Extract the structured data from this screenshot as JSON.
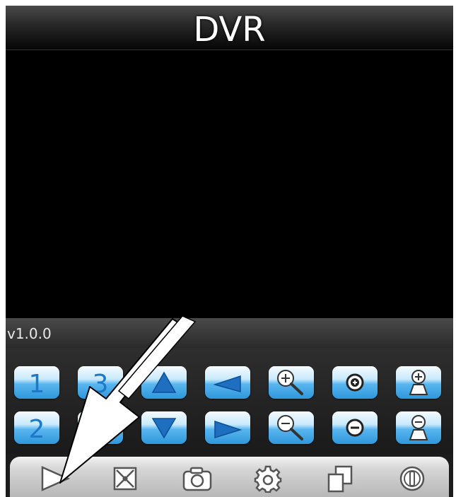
{
  "app": {
    "title": "DVR",
    "version": "v1.0.0"
  },
  "controls": {
    "channel_1": "1",
    "channel_2": "2",
    "channel_3": "3",
    "row1_icons": [
      "tilt-up-icon",
      "pan-left-icon",
      "zoom-in-icon",
      "focus-in-icon",
      "iris-open-icon"
    ],
    "row2_icons": [
      "tilt-down-icon",
      "pan-right-icon",
      "zoom-out-icon",
      "focus-out-icon",
      "iris-close-icon"
    ]
  },
  "toolbar": {
    "icons": [
      "play-icon",
      "stop-icon",
      "camera-icon",
      "gear-icon",
      "multi-view-icon",
      "info-icon"
    ]
  },
  "colors": {
    "button_blue": "#2f97dc",
    "digit_blue": "#1e78c8",
    "icon_gray": "#555555",
    "background": "#000000"
  }
}
